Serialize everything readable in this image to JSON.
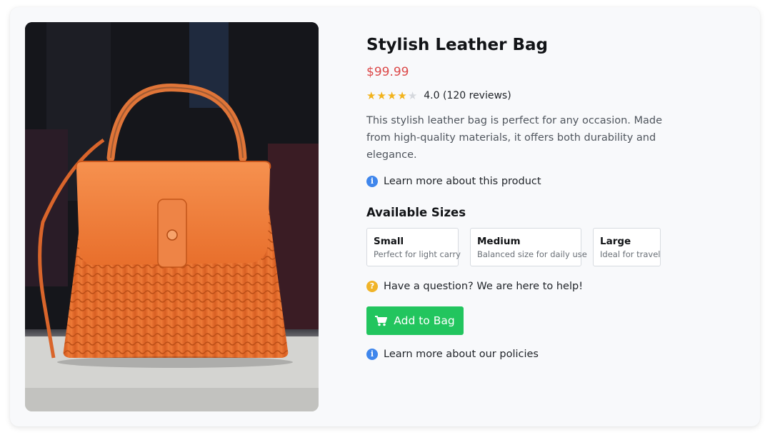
{
  "product": {
    "title": "Stylish Leather Bag",
    "price": "$99.99",
    "rating_value": 4,
    "rating_max": 5,
    "rating_text": "4.0 (120 reviews)",
    "description": "This stylish leather bag is perfect for any occasion. Made from high-quality materials, it offers both durability and elegance.",
    "learn_more_product": "Learn more about this product",
    "sizes_heading": "Available Sizes",
    "sizes": [
      {
        "name": "Small",
        "description": "Perfect for light carry"
      },
      {
        "name": "Medium",
        "description": "Balanced size for daily use"
      },
      {
        "name": "Large",
        "description": "Ideal for travel"
      }
    ],
    "question_text": "Have a question? We are here to help!",
    "add_button_label": "Add to Bag",
    "learn_more_policies": "Learn more about our policies"
  },
  "icons": {
    "info": "info-circle-icon",
    "question": "question-circle-icon",
    "cart": "shopping-cart-icon",
    "star": "star-icon"
  },
  "colors": {
    "price": "#dc4a4a",
    "accent_button": "#22c55e",
    "star_filled": "#f2b31b",
    "star_empty": "#d5d8dd",
    "info_icon": "#3f86ec",
    "question_icon": "#f0b429",
    "bag": "#f07a3a"
  }
}
